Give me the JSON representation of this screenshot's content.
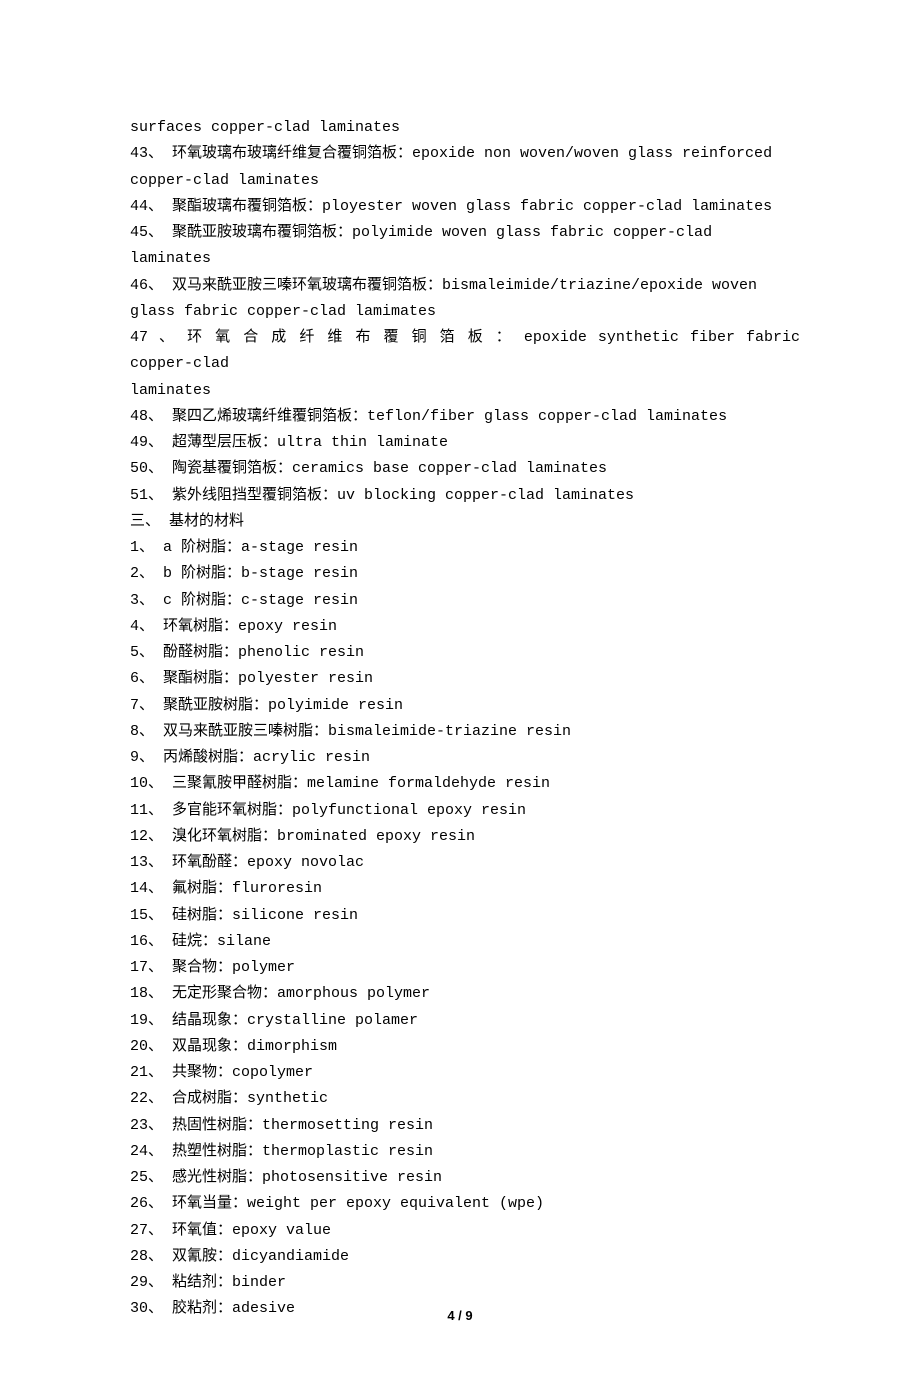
{
  "lines": [
    {
      "cls": "last-line",
      "text": "surfaces copper-clad laminates"
    },
    {
      "cls": "line",
      "text": "43、 环氧玻璃布玻璃纤维复合覆铜箔板：epoxide non woven/woven glass reinforced"
    },
    {
      "cls": "last-line",
      "text": "copper-clad laminates"
    },
    {
      "cls": "last-line",
      "text": "44、 聚酯玻璃布覆铜箔板：ployester woven glass fabric copper-clad laminates"
    },
    {
      "cls": "last-line",
      "text": "45、 聚酰亚胺玻璃布覆铜箔板：polyimide woven glass fabric copper-clad laminates"
    },
    {
      "cls": "line",
      "text": "46、 双马来酰亚胺三嗪环氧玻璃布覆铜箔板：bismaleimide/triazine/epoxide woven"
    },
    {
      "cls": "last-line",
      "text": "glass fabric copper-clad lamimates"
    },
    {
      "cls": "wide",
      "text": "47 、  环 氧 合 成 纤 维 布 覆 铜 箔 板 ： epoxide  synthetic  fiber  fabric  copper-clad"
    },
    {
      "cls": "last-line",
      "text": "laminates"
    },
    {
      "cls": "last-line",
      "text": "48、 聚四乙烯玻璃纤维覆铜箔板：teflon/fiber glass copper-clad laminates"
    },
    {
      "cls": "last-line",
      "text": "49、 超薄型层压板：ultra thin laminate"
    },
    {
      "cls": "last-line",
      "text": "50、 陶瓷基覆铜箔板：ceramics base copper-clad laminates"
    },
    {
      "cls": "last-line",
      "text": "51、 紫外线阻挡型覆铜箔板：uv blocking copper-clad laminates"
    },
    {
      "cls": "last-line",
      "text": "三、 基材的材料"
    },
    {
      "cls": "last-line",
      "text": "1、 a 阶树脂：a-stage resin"
    },
    {
      "cls": "last-line",
      "text": "2、 b 阶树脂：b-stage resin"
    },
    {
      "cls": "last-line",
      "text": "3、 c 阶树脂：c-stage resin"
    },
    {
      "cls": "last-line",
      "text": "4、 环氧树脂：epoxy resin"
    },
    {
      "cls": "last-line",
      "text": "5、 酚醛树脂：phenolic resin"
    },
    {
      "cls": "last-line",
      "text": "6、 聚酯树脂：polyester resin"
    },
    {
      "cls": "last-line",
      "text": "7、 聚酰亚胺树脂：polyimide resin"
    },
    {
      "cls": "last-line",
      "text": "8、 双马来酰亚胺三嗪树脂：bismaleimide-triazine resin"
    },
    {
      "cls": "last-line",
      "text": "9、 丙烯酸树脂：acrylic resin"
    },
    {
      "cls": "last-line",
      "text": "10、 三聚氰胺甲醛树脂：melamine formaldehyde resin"
    },
    {
      "cls": "last-line",
      "text": "11、 多官能环氧树脂：polyfunctional epoxy resin"
    },
    {
      "cls": "last-line",
      "text": "12、 溴化环氧树脂：brominated epoxy resin"
    },
    {
      "cls": "last-line",
      "text": "13、 环氧酚醛：epoxy novolac"
    },
    {
      "cls": "last-line",
      "text": "14、 氟树脂：fluroresin"
    },
    {
      "cls": "last-line",
      "text": "15、 硅树脂：silicone resin"
    },
    {
      "cls": "last-line",
      "text": "16、 硅烷：silane"
    },
    {
      "cls": "last-line",
      "text": "17、 聚合物：polymer"
    },
    {
      "cls": "last-line",
      "text": "18、 无定形聚合物：amorphous polymer"
    },
    {
      "cls": "last-line",
      "text": "19、 结晶现象：crystalline polamer"
    },
    {
      "cls": "last-line",
      "text": "20、 双晶现象：dimorphism"
    },
    {
      "cls": "last-line",
      "text": "21、 共聚物：copolymer"
    },
    {
      "cls": "last-line",
      "text": "22、 合成树脂：synthetic"
    },
    {
      "cls": "last-line",
      "text": "23、 热固性树脂：thermosetting resin"
    },
    {
      "cls": "last-line",
      "text": "24、 热塑性树脂：thermoplastic resin"
    },
    {
      "cls": "last-line",
      "text": "25、 感光性树脂：photosensitive resin"
    },
    {
      "cls": "last-line",
      "text": "26、 环氧当量：weight per epoxy equivalent (wpe)"
    },
    {
      "cls": "last-line",
      "text": "27、 环氧值：epoxy value"
    },
    {
      "cls": "last-line",
      "text": "28、 双氰胺：dicyandiamide"
    },
    {
      "cls": "last-line",
      "text": "29、 粘结剂：binder"
    },
    {
      "cls": "last-line",
      "text": "30、 胶粘剂：adesive"
    }
  ],
  "footer": "4 / 9"
}
